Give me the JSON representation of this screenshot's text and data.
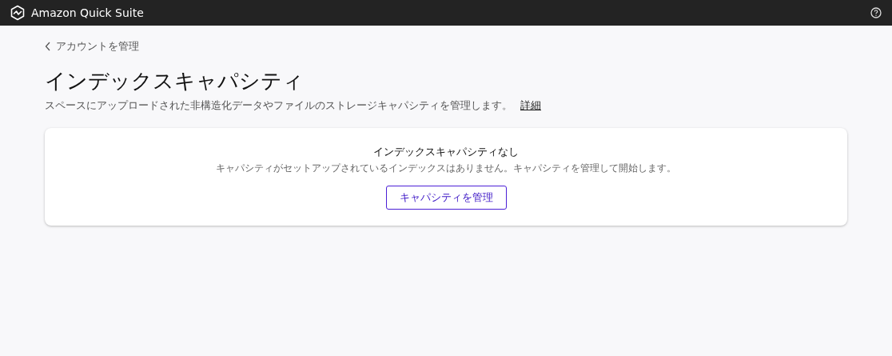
{
  "top_bar": {
    "app_name": "Amazon Quick Suite"
  },
  "back_link": "アカウントを管理",
  "page": {
    "title": "インデックスキャパシティ",
    "description": "スペースにアップロードされた非構造化データやファイルのストレージキャパシティを管理します。",
    "details_link": "詳細"
  },
  "empty_state": {
    "title": "インデックスキャパシティなし",
    "message": "キャパシティがセットアップされているインデックスはありません。キャパシティを管理して開始します。",
    "button": "キャパシティを管理"
  }
}
